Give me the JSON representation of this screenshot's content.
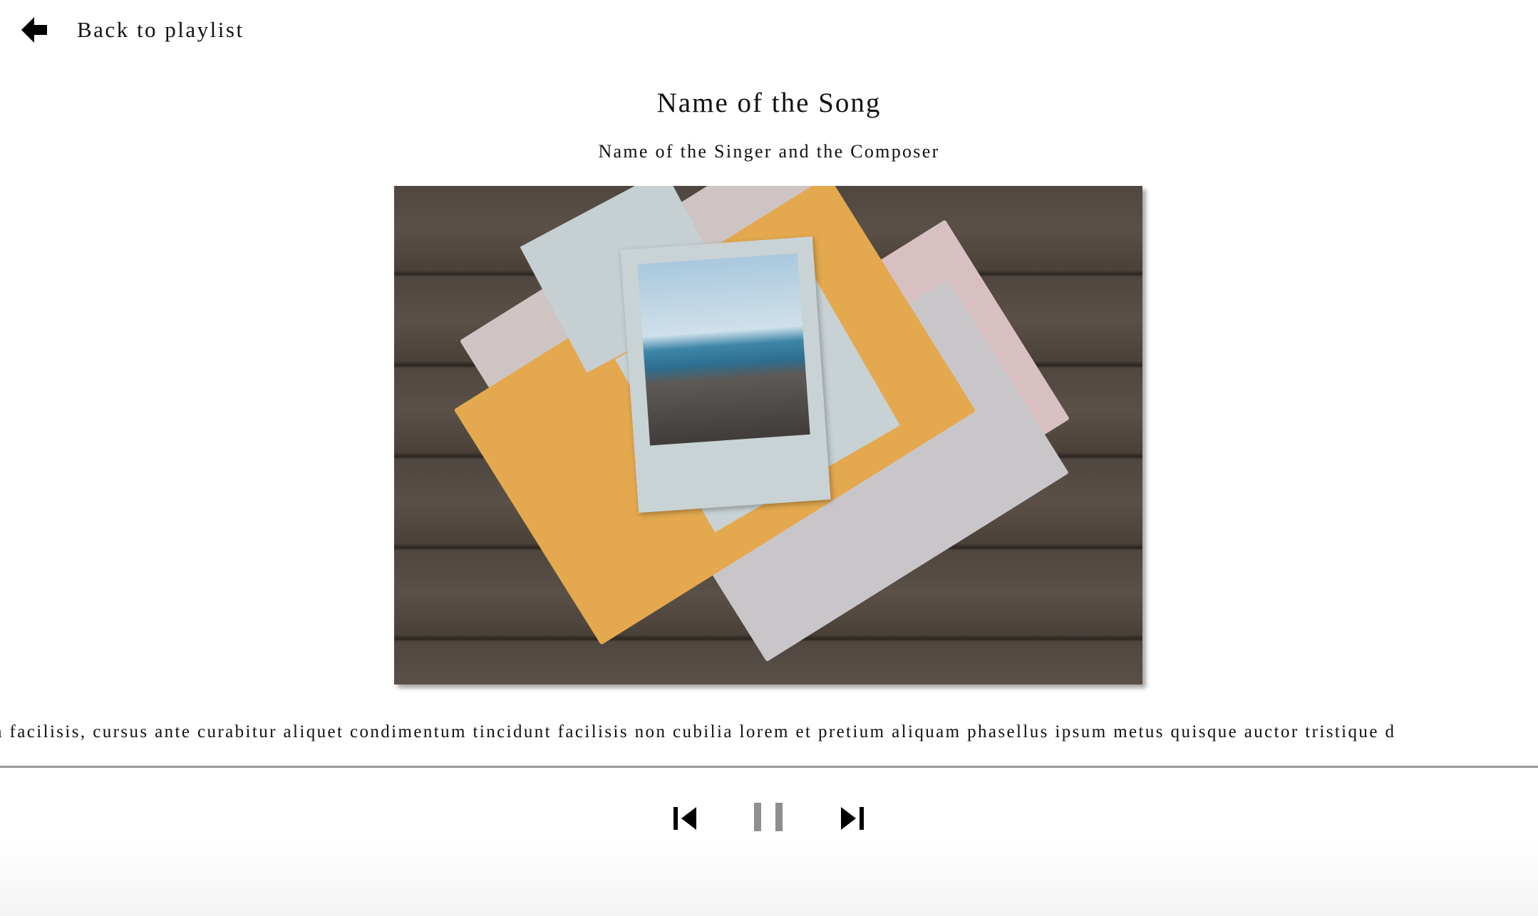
{
  "nav": {
    "back_label": "Back to playlist",
    "back_icon": "arrow-left-icon"
  },
  "song": {
    "title": "Name of the Song",
    "artist": "Name of the Singer and the Composer"
  },
  "lyrics": {
    "scrolling_text": "n facilisis, cursus ante curabitur aliquet condimentum tincidunt facilisis non cubilia lorem et pretium aliquam phasellus ipsum metus quisque auctor tristique d"
  },
  "player": {
    "state": "playing",
    "controls": [
      "previous-track-icon",
      "pause-icon",
      "next-track-icon"
    ],
    "colors": {
      "pause": "#8f8f8f",
      "skip": "#000000",
      "divider": "#9a9a9a"
    }
  }
}
